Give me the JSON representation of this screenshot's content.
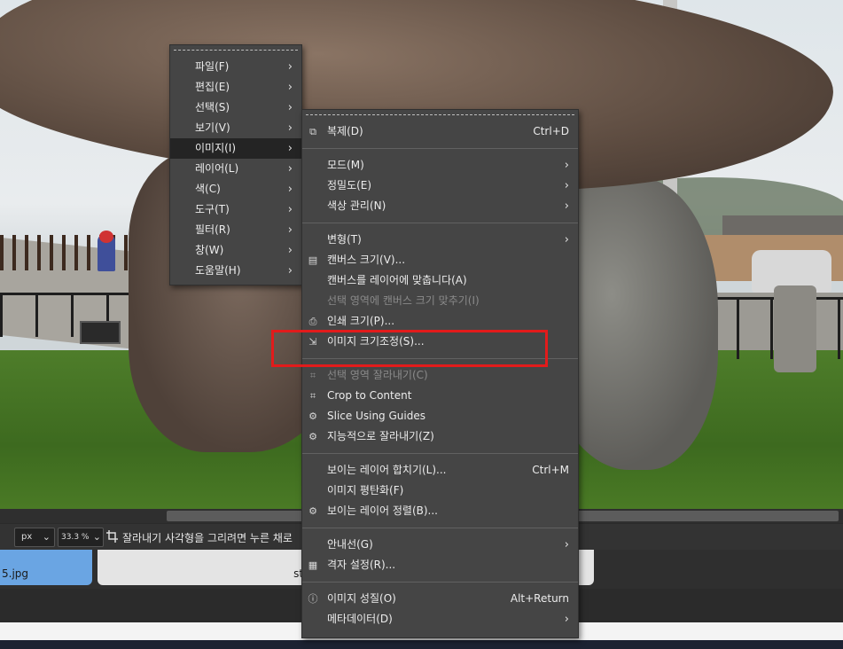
{
  "statusbar": {
    "unit": "px",
    "zoom": "33.3 %",
    "message": "잘라내기 사각형을 그리려면 누른 채로"
  },
  "tabs": [
    {
      "label": "5.jpg"
    },
    {
      "label": "standard-setup.png"
    }
  ],
  "main_menu": {
    "items": [
      {
        "label": "파일(F)"
      },
      {
        "label": "편집(E)"
      },
      {
        "label": "선택(S)"
      },
      {
        "label": "보기(V)"
      },
      {
        "label": "이미지(I)"
      },
      {
        "label": "레이어(L)"
      },
      {
        "label": "색(C)"
      },
      {
        "label": "도구(T)"
      },
      {
        "label": "필터(R)"
      },
      {
        "label": "창(W)"
      },
      {
        "label": "도움말(H)"
      }
    ],
    "active": "이미지(I)"
  },
  "image_menu": {
    "duplicate": {
      "label": "복제(D)",
      "shortcut": "Ctrl+D",
      "icon": "duplicate-icon"
    },
    "mode": {
      "label": "모드(M)"
    },
    "precision": {
      "label": "정밀도(E)"
    },
    "color_management": {
      "label": "색상 관리(N)"
    },
    "transform": {
      "label": "변형(T)"
    },
    "canvas_size": {
      "label": "캔버스 크기(V)...",
      "icon": "canvas-size-icon"
    },
    "fit_canvas_layers": {
      "label": "캔버스를 레이어에 맞춥니다(A)"
    },
    "fit_canvas_selection": {
      "label": "선택 영역에 캔버스 크기 맞추기(I)"
    },
    "print_size": {
      "label": "인쇄 크기(P)...",
      "icon": "print-icon"
    },
    "scale_image": {
      "label": "이미지 크기조정(S)...",
      "icon": "scale-image-icon"
    },
    "crop_to_selection": {
      "label": "선택 영역 잘라내기(C)",
      "icon": "crop-icon"
    },
    "crop_to_content": {
      "label": "Crop to Content",
      "icon": "crop-icon"
    },
    "slice_using_guides": {
      "label": "Slice Using Guides",
      "icon": "slice-icon"
    },
    "zealous_crop": {
      "label": "지능적으로 잘라내기(Z)",
      "icon": "zealous-crop-icon"
    },
    "merge_visible": {
      "label": "보이는 레이어 합치기(L)...",
      "shortcut": "Ctrl+M"
    },
    "flatten": {
      "label": "이미지 평탄화(F)"
    },
    "align_visible": {
      "label": "보이는 레이어 정렬(B)...",
      "icon": "align-icon"
    },
    "guides": {
      "label": "안내선(G)"
    },
    "configure_grid": {
      "label": "격자 설정(R)...",
      "icon": "grid-icon"
    },
    "properties": {
      "label": "이미지 성질(O)",
      "shortcut": "Alt+Return",
      "icon": "info-icon"
    },
    "metadata": {
      "label": "메타데이터(D)"
    }
  },
  "colors": {
    "menu_bg": "#454545",
    "highlight_border": "#e21b1b",
    "active_tab": "#6aa5e3"
  }
}
